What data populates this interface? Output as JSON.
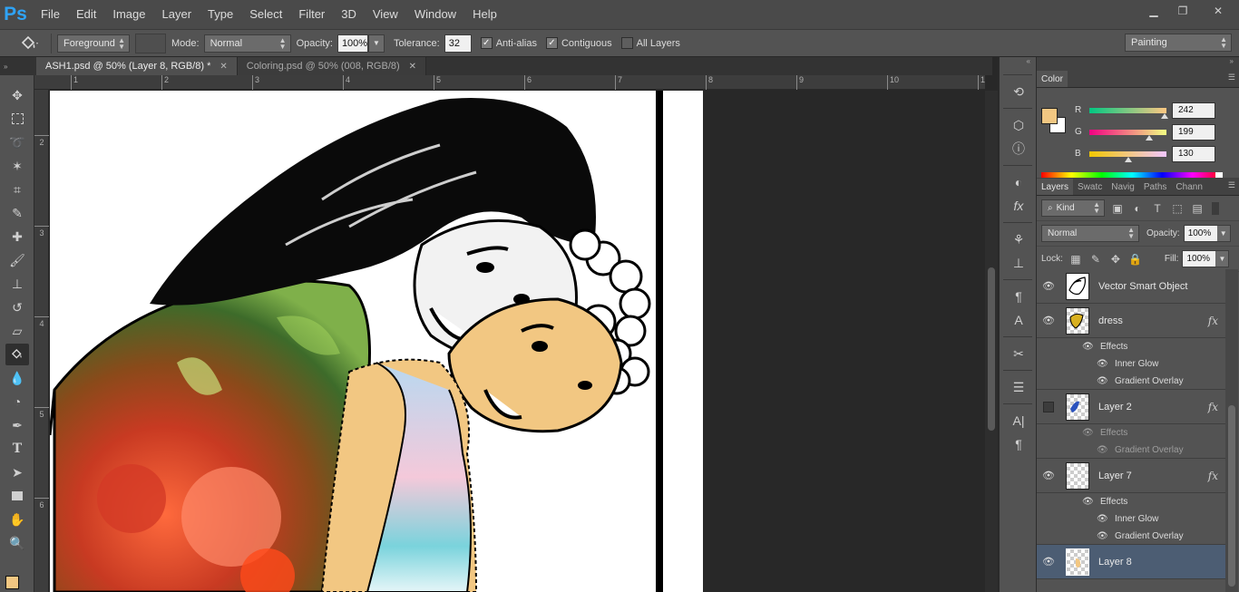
{
  "app": {
    "logo": "Ps"
  },
  "menu": [
    "File",
    "Edit",
    "Image",
    "Layer",
    "Type",
    "Select",
    "Filter",
    "3D",
    "View",
    "Window",
    "Help"
  ],
  "window_controls": {
    "minimize": "▁",
    "restore": "❐",
    "close": "✕"
  },
  "options": {
    "fill_source": "Foreground",
    "mode_label": "Mode:",
    "mode_value": "Normal",
    "opacity_label": "Opacity:",
    "opacity_value": "100%",
    "tolerance_label": "Tolerance:",
    "tolerance_value": "32",
    "anti_alias": "Anti-alias",
    "contiguous": "Contiguous",
    "all_layers": "All Layers",
    "workspace": "Painting"
  },
  "tabs": [
    {
      "label": "ASH1.psd @ 50% (Layer 8, RGB/8) *",
      "close": "✕"
    },
    {
      "label": "Coloring.psd @ 50% (008, RGB/8)",
      "close": "✕"
    }
  ],
  "ruler_h": [
    "1",
    "2",
    "3",
    "4",
    "5",
    "6",
    "7",
    "8",
    "9",
    "10",
    "1"
  ],
  "ruler_v": [
    "2",
    "3",
    "4",
    "5",
    "6"
  ],
  "color_panel": {
    "tab": "Color",
    "fg_color": "#f2c782",
    "r_label": "R",
    "r_value": "242",
    "g_label": "G",
    "g_value": "199",
    "b_label": "B",
    "b_value": "130"
  },
  "layers_panel": {
    "tabs": [
      "Layers",
      "Swatc",
      "Navig",
      "Paths",
      "Chann"
    ],
    "kind": "Kind",
    "blend_mode": "Normal",
    "opacity_label": "Opacity:",
    "opacity_value": "100%",
    "lock_label": "Lock:",
    "fill_label": "Fill:",
    "fill_value": "100%",
    "fx_symbol": "fx",
    "effects_label": "Effects",
    "layers": [
      {
        "name": "Vector Smart Object"
      },
      {
        "name": "dress",
        "effects": [
          "Inner Glow",
          "Gradient Overlay"
        ]
      },
      {
        "name": "Layer 2",
        "effects": [
          "Gradient Overlay"
        ]
      },
      {
        "name": "Layer 7",
        "effects": [
          "Inner Glow",
          "Gradient Overlay"
        ]
      },
      {
        "name": "Layer 8"
      }
    ]
  }
}
